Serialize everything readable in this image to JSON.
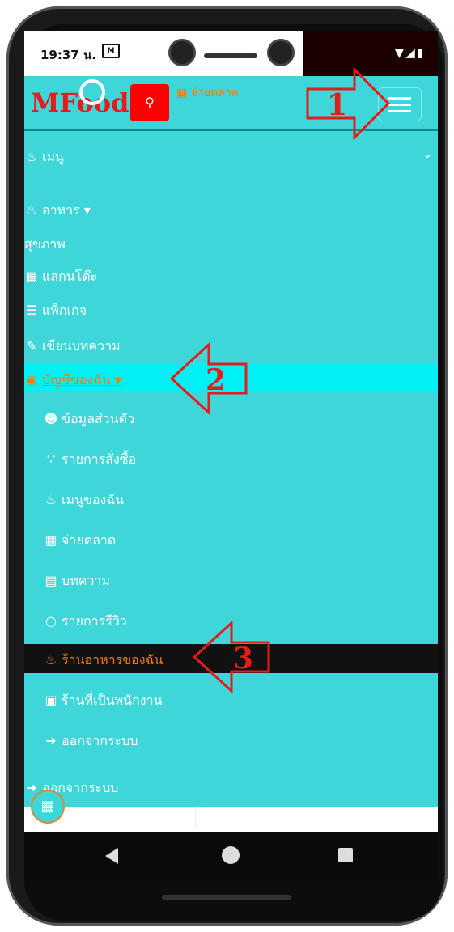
{
  "status": {
    "time": "19:37 น.",
    "msg_icon": "M",
    "sys_icons": "▼◢▮"
  },
  "header": {
    "logo": "MFood",
    "market": "จ่ายตลาด"
  },
  "menu": {
    "menu_title": "เมนู",
    "food": "อาหาร ▾",
    "health": "สุขภาพ",
    "scan": "แสกนโต๊ะ",
    "package": "แพ็กเกจ",
    "write": "เขียนบทความ",
    "account": "บัญชีของฉัน ▾",
    "sub": {
      "profile": "ข้อมูลส่วนตัว",
      "orders": "รายการสั่งซื้อ",
      "mymenu": "เมนูของฉัน",
      "market": "จ่ายตลาด",
      "article": "บทความ",
      "review": "รายการรีวิว",
      "myrestaurant": "ร้านอาหารของฉัน",
      "employee": "ร้านที่เป็นพนักงาน",
      "logout": "ออกจากระบบ"
    },
    "logout": "ออกจากระบบ"
  },
  "annotations": {
    "a1": "1",
    "a2": "2",
    "a3": "3"
  },
  "colors": {
    "nav": "#3ed6d8",
    "highlight": "#00f0f5",
    "accent": "#ff7a00",
    "annotation": "#e31c1c"
  }
}
